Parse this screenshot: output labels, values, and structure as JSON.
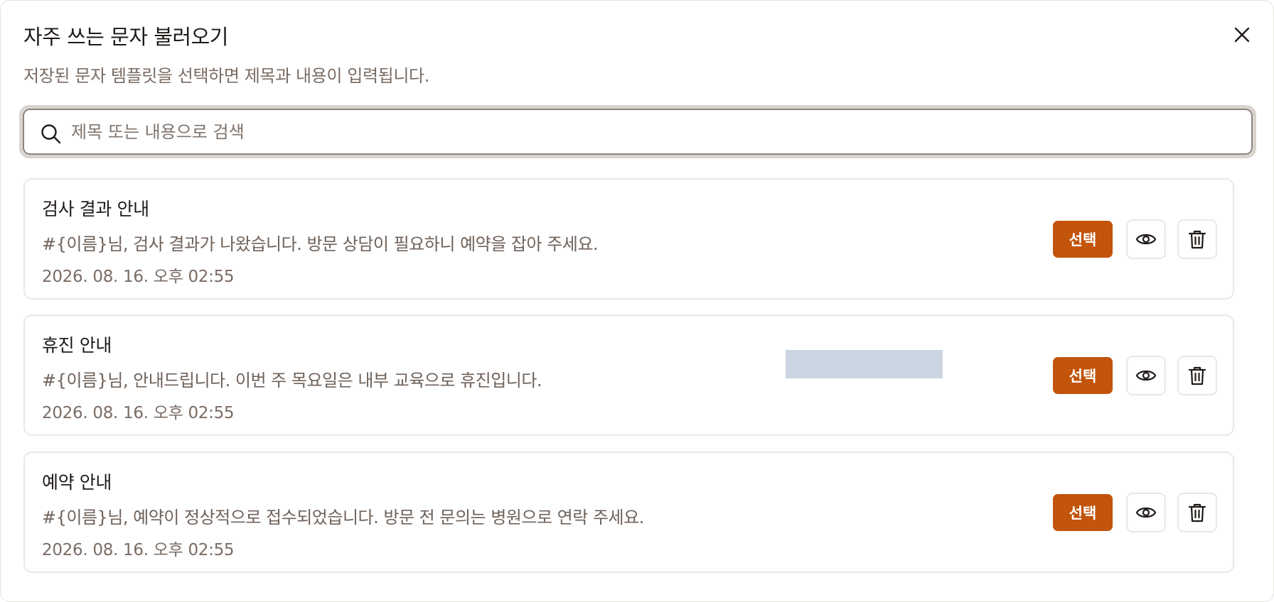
{
  "dialog": {
    "title": "자주 쓰는 문자 불러오기",
    "subtitle": "저장된 문자 템플릿을 선택하면 제목과 내용이 입력됩니다.",
    "close_icon": "close-icon"
  },
  "search": {
    "placeholder": "제목 또는 내용으로 검색",
    "value": "",
    "icon": "search-icon"
  },
  "templates": [
    {
      "title": "검사 결과 안내",
      "body": "#{이름}님, 검사 결과가 나왔습니다. 방문 상담이 필요하니 예약을 잡아 주세요.",
      "date": "2026. 08. 16. 오후 02:55",
      "select_label": "선택"
    },
    {
      "title": "휴진 안내",
      "body": "#{이름}님, 안내드립니다. 이번 주 목요일은 내부 교육으로 휴진입니다.",
      "date": "2026. 08. 16. 오후 02:55",
      "select_label": "선택"
    },
    {
      "title": "예약 안내",
      "body": "#{이름}님, 예약이 정상적으로 접수되었습니다. 방문 전 문의는 병원으로 연락 주세요.",
      "date": "2026. 08. 16. 오후 02:55",
      "select_label": "선택"
    }
  ],
  "icons": {
    "preview": "eye-icon",
    "delete": "trash-icon"
  },
  "colors": {
    "accent": "#c2540b",
    "text_primary": "#1f1a17",
    "text_secondary": "#7a6c64",
    "border": "#ebe8e4",
    "placeholder_block": "#cbd5e1"
  }
}
